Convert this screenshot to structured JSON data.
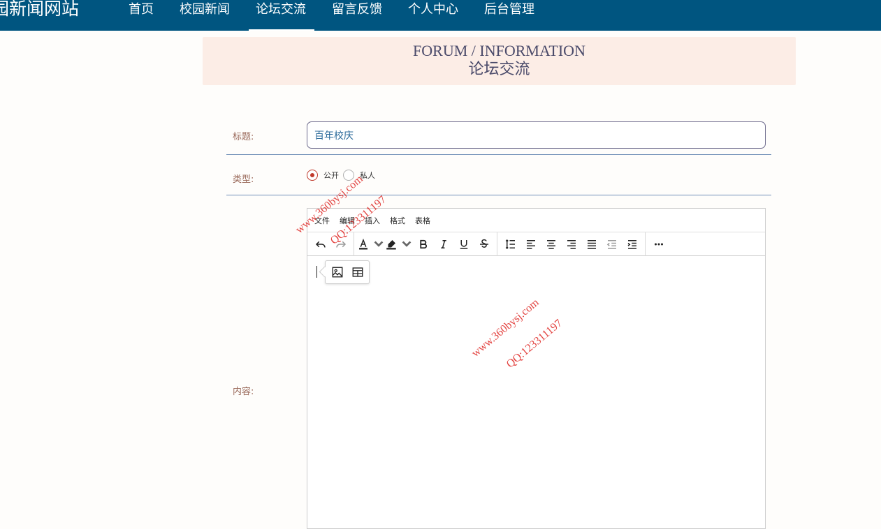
{
  "header": {
    "site_title": "园新闻网站",
    "nav": [
      {
        "label": "首页",
        "active": false
      },
      {
        "label": "校园新闻",
        "active": false
      },
      {
        "label": "论坛交流",
        "active": true
      },
      {
        "label": "留言反馈",
        "active": false
      },
      {
        "label": "个人中心",
        "active": false
      },
      {
        "label": "后台管理",
        "active": false
      }
    ]
  },
  "banner": {
    "en": "FORUM / INFORMATION",
    "cn": "论坛交流"
  },
  "form": {
    "title_label": "标题:",
    "title_value": "百年校庆",
    "type_label": "类型:",
    "type_options": [
      {
        "label": "公开",
        "checked": true
      },
      {
        "label": "私人",
        "checked": false
      }
    ],
    "content_label": "内容:"
  },
  "editor": {
    "menu": [
      "文件",
      "编辑",
      "插入",
      "格式",
      "表格"
    ],
    "toolbar_icons": [
      "undo-icon",
      "redo-icon",
      "text-color-icon",
      "highlight-icon",
      "bold-icon",
      "italic-icon",
      "underline-icon",
      "strikethrough-icon",
      "line-height-icon",
      "align-left-icon",
      "align-center-icon",
      "align-right-icon",
      "align-justify-icon",
      "outdent-icon",
      "indent-icon",
      "more-icon"
    ],
    "quickbar_icons": [
      "image-icon",
      "table-icon"
    ]
  },
  "watermark": {
    "site": "www.360bysj.com",
    "qq": "QQ:123311197"
  },
  "colors": {
    "topbar": "#005580",
    "banner_bg": "#fcede6",
    "label": "#9b6b5c",
    "radio_checked": "#c0392b",
    "watermark": "#e0312e"
  }
}
